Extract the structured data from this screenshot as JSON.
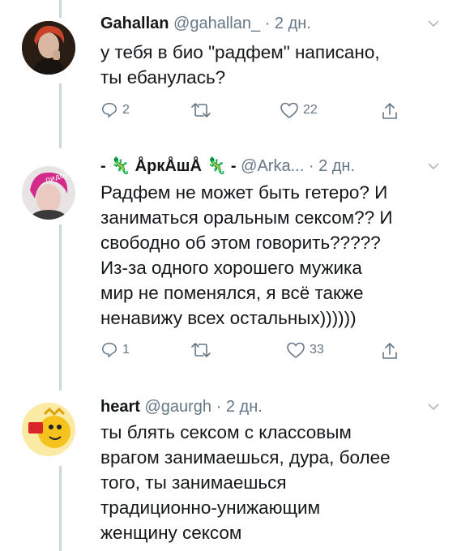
{
  "tweets": [
    {
      "name": "Gahallan",
      "handle": "@gahallan_",
      "time": "2 дн.",
      "text_lines": [
        "у тебя в био \"радфем\" написано,",
        "ты ебанулась?"
      ],
      "replies": "2",
      "retweets": "",
      "likes": "22"
    },
    {
      "name_prefix": "- ",
      "lizard": "🦎",
      "name_core": " ÅркÅшÅ ",
      "name_suffix": " -",
      "handle": "@Arka...",
      "time": "2 дн.",
      "avatar_sticker": "пидорас",
      "text_lines": [
        "Радфем не может быть гетеро? И",
        "заниматься оральным сексом?? И",
        "свободно об этом говорить?????",
        "Из-за одного хорошего мужика",
        "мир не поменялся, я всё также",
        "ненавижу всех остальных))))))"
      ],
      "replies": "1",
      "retweets": "",
      "likes": "33"
    },
    {
      "name": "heart",
      "handle": "@gaurgh",
      "time": "2 дн.",
      "text_lines": [
        "ты блять сексом с классовым",
        "врагом занимаешься, дура, более",
        "того, ты занимаешься",
        "традиционно-унижающим",
        "женщину сексом"
      ]
    }
  ],
  "icons": {
    "reply": "reply-icon",
    "retweet": "retweet-icon",
    "like": "heart-icon",
    "share": "share-icon",
    "caret": "chevron-down-icon"
  },
  "colors": {
    "text": "#14171a",
    "secondary": "#657786",
    "thread_line": "#ccd6dd"
  }
}
